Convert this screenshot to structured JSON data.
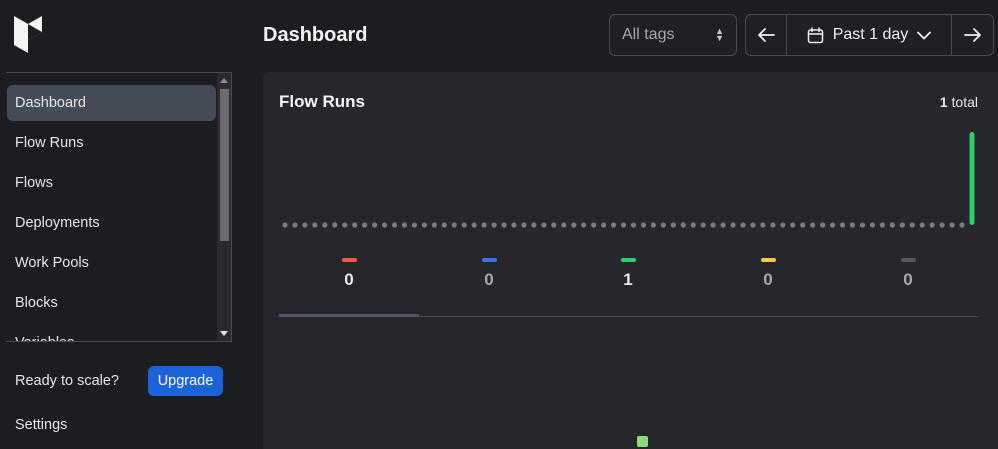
{
  "sidebar": {
    "items": [
      {
        "label": "Dashboard",
        "active": true
      },
      {
        "label": "Flow Runs"
      },
      {
        "label": "Flows"
      },
      {
        "label": "Deployments"
      },
      {
        "label": "Work Pools"
      },
      {
        "label": "Blocks"
      },
      {
        "label": "Variables"
      }
    ],
    "upgrade_prompt": "Ready to scale?",
    "upgrade_button": "Upgrade",
    "settings_label": "Settings"
  },
  "header": {
    "title": "Dashboard",
    "tags_placeholder": "All tags",
    "range_label": "Past 1 day"
  },
  "flow_runs": {
    "title": "Flow Runs",
    "total_count": "1",
    "total_label": "total",
    "stats": [
      {
        "value": "0",
        "color": "#ef5a3c"
      },
      {
        "value": "0",
        "color": "#3d73e6"
      },
      {
        "value": "1",
        "color": "#2bd16a"
      },
      {
        "value": "0",
        "color": "#f2c94c"
      },
      {
        "value": "0",
        "color": "#55575d"
      }
    ],
    "active_tab_index": 0
  },
  "colors": {
    "accent": "#1b63d8",
    "success": "#2bd16a",
    "background": "#1c1d21",
    "card": "#26272c"
  },
  "chart_data": {
    "type": "bar",
    "series": [
      {
        "values": [
          0,
          0,
          0,
          0,
          0,
          0,
          0,
          0,
          0,
          0,
          0,
          0,
          0,
          0,
          0,
          0,
          0,
          0,
          0,
          0,
          0,
          0,
          0,
          0,
          0,
          0,
          0,
          0,
          0,
          0,
          0,
          0,
          0,
          0,
          0,
          0,
          0,
          0,
          0,
          0,
          0,
          0,
          0,
          0,
          0,
          0,
          0,
          0,
          0,
          0,
          0,
          0,
          0,
          0,
          0,
          0,
          0,
          0,
          0,
          0,
          0,
          0,
          0,
          0,
          0,
          0,
          0,
          0,
          0,
          1
        ]
      }
    ],
    "bar_color": "#2bd16a",
    "zero_marker_color": "#7a7c82"
  }
}
